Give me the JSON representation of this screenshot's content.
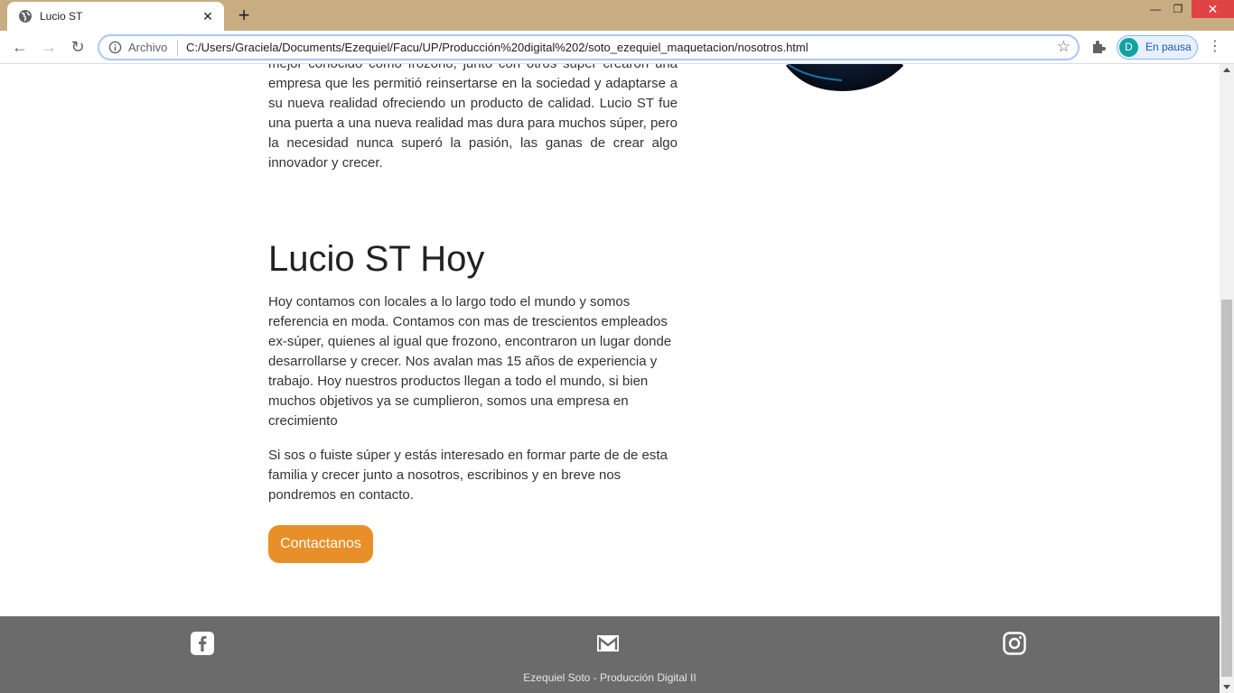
{
  "browser": {
    "tab_title": "Lucio ST",
    "tab_close": "✕",
    "new_tab": "+",
    "scheme_label": "Archivo",
    "url": "C:/Users/Graciela/Documents/Ezequiel/Facu/UP/Producción%20digital%202/soto_ezequiel_maquetacion/nosotros.html",
    "profile_initial": "D",
    "profile_status": "En pausa",
    "bookmark_star": "☆",
    "menu": "⋮"
  },
  "page": {
    "intro_text": "mejor conocido como frozono, junto con otros súper crearon una empresa que les permitió reinsertarse en la sociedad y adaptarse a su nueva realidad ofreciendo un producto de calidad. Lucio ST fue una puerta a una nueva realidad mas dura para muchos súper, pero la necesidad nunca superó la pasión, las ganas de crear algo innovador y crecer.",
    "section_title": "Lucio ST Hoy",
    "paragraph_1": "Hoy contamos con locales a lo largo todo el mundo y somos referencia en moda. Contamos con mas de trescientos empleados ex-súper, quienes al igual que frozono, encontraron un lugar donde desarrollarse y crecer. Nos avalan mas 15 años de experiencia y trabajo. Hoy nuestros productos llegan a todo el mundo, si bien muchos objetivos ya se cumplieron, somos una empresa en crecimiento",
    "paragraph_2": "Si sos o fuiste súper y estás interesado en formar parte de de esta familia y crecer junto a nosotros, escribinos y en breve nos pondremos en contacto.",
    "cta_label": "Contactanos"
  },
  "footer": {
    "credit": "Ezequiel Soto - Producción Digital II",
    "icons": [
      "facebook-icon",
      "mail-icon",
      "instagram-icon"
    ]
  },
  "colors": {
    "titlebar": "#c8ad82",
    "accent_button": "#e98f29",
    "footer_bg": "#6b6b6b"
  }
}
